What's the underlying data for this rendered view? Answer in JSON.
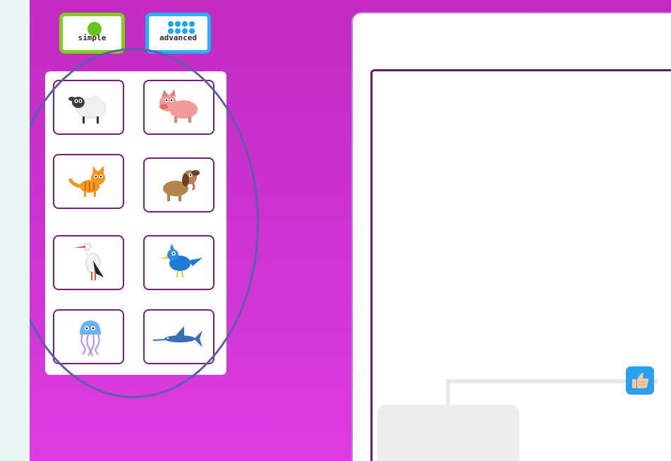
{
  "mode_buttons": {
    "simple_label": "simple",
    "advanced_label": "advanced"
  },
  "palette": {
    "animals": [
      "sheep",
      "pig",
      "cat",
      "dog",
      "stork",
      "bird",
      "jellyfish",
      "swordfish"
    ]
  },
  "colors": {
    "stage_background": "#cf33d4",
    "simple_accent": "#7fcf16",
    "advanced_accent": "#25b1f5",
    "tile_border": "#7a1f78",
    "workspace_border": "#6a1a62",
    "selection_ellipse": "#5b5fa8",
    "thumb_button": "#2aa0ef"
  },
  "icons": {
    "thumb_button": "thumbs-up-icon"
  }
}
